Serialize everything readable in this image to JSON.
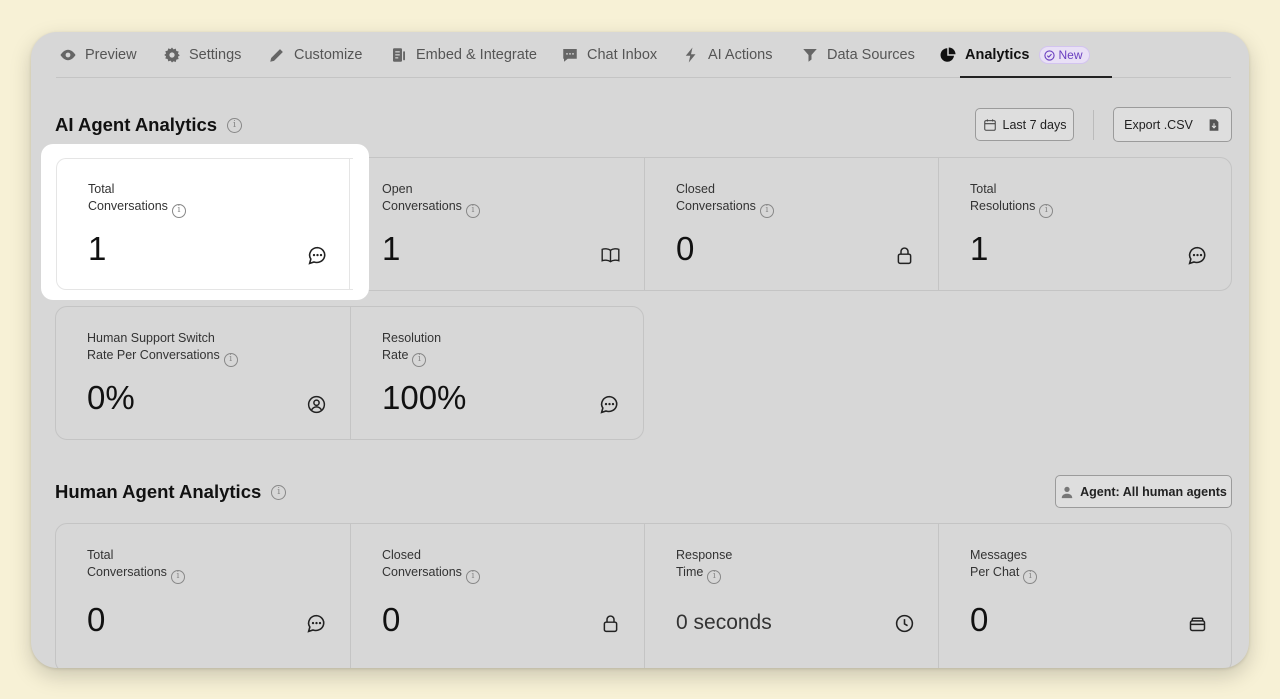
{
  "tabs": [
    {
      "label": "Preview",
      "icon": "eye-icon"
    },
    {
      "label": "Settings",
      "icon": "gear-icon"
    },
    {
      "label": "Customize",
      "icon": "pencil-icon"
    },
    {
      "label": "Embed & Integrate",
      "icon": "embed-icon"
    },
    {
      "label": "Chat Inbox",
      "icon": "chat-bubble-icon"
    },
    {
      "label": "AI Actions",
      "icon": "bolt-icon"
    },
    {
      "label": "Data Sources",
      "icon": "funnel-icon"
    },
    {
      "label": "Analytics",
      "icon": "pie-chart-icon",
      "active": true,
      "badge": "New"
    }
  ],
  "ai_section": {
    "title": "AI Agent Analytics",
    "date_button": "Last 7 days",
    "export_button": "Export .CSV",
    "cards": [
      {
        "label_line1": "Total",
        "label_line2": "Conversations",
        "value": "1",
        "icon": "chat-dots-icon"
      },
      {
        "label_line1": "Open",
        "label_line2": "Conversations",
        "value": "1",
        "icon": "book-open-icon"
      },
      {
        "label_line1": "Closed",
        "label_line2": "Conversations",
        "value": "0",
        "icon": "lock-icon"
      },
      {
        "label_line1": "Total",
        "label_line2": "Resolutions",
        "value": "1",
        "icon": "chat-dots-icon"
      },
      {
        "label_line1": "Human Support Switch",
        "label_line2": "Rate Per Conversations",
        "value": "0%",
        "icon": "user-circle-icon"
      },
      {
        "label_line1": "Resolution",
        "label_line2": "Rate",
        "value": "100%",
        "icon": "chat-dots-icon"
      }
    ]
  },
  "human_section": {
    "title": "Human Agent Analytics",
    "agent_filter": "Agent: All human agents",
    "cards": [
      {
        "label_line1": "Total",
        "label_line2": "Conversations",
        "value": "0",
        "icon": "chat-dots-icon"
      },
      {
        "label_line1": "Closed",
        "label_line2": "Conversations",
        "value": "0",
        "icon": "lock-icon"
      },
      {
        "label_line1": "Response",
        "label_line2": "Time",
        "value": "0 seconds",
        "icon": "clock-icon"
      },
      {
        "label_line1": "Messages",
        "label_line2": "Per Chat",
        "value": "0",
        "icon": "inbox-stack-icon"
      }
    ]
  },
  "colors": {
    "background": "#f7f1d6",
    "panel": "#d7d7d7",
    "badge_purple": "#6a3fc0"
  }
}
